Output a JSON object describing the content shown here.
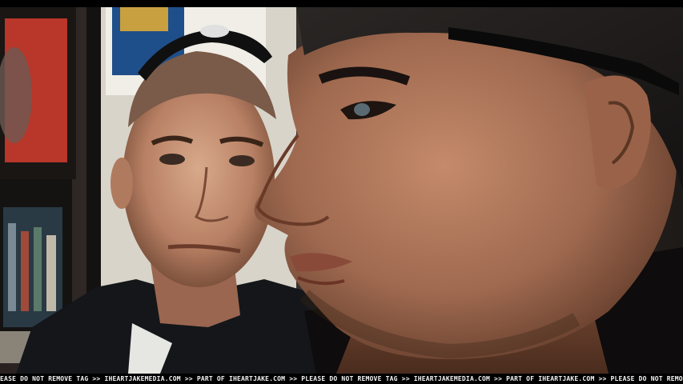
{
  "watermark": {
    "text": "PLEASE DO NOT REMOVE TAG >> IHEARTJAKEMEDIA.COM >> PART OF IHEARTJAKE.COM >> PLEASE DO NOT REMOVE TAG >> IHEARTJAKEMEDIA.COM >> PART OF IHEARTJAKE.COM >> PLEASE DO NOT REMOVE TAG >> IHEARTJAKEMEDIA.COM"
  },
  "colors": {
    "letterbox": "#000000",
    "skin_right": "#b07a5e",
    "skin_left": "#c9977a",
    "background_red": "#b8362a",
    "uniform": "#14161a"
  }
}
